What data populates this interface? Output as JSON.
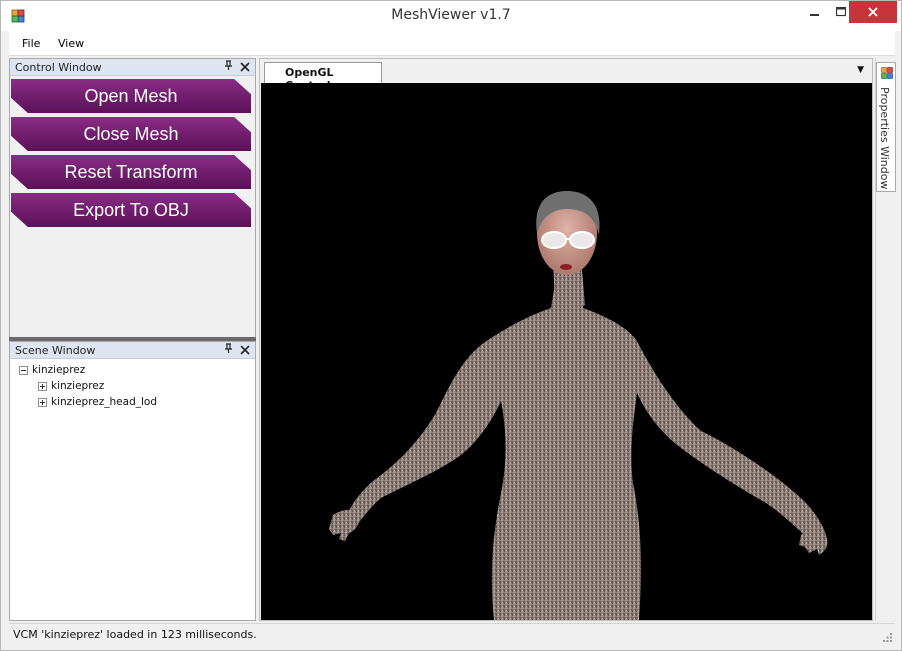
{
  "window": {
    "title": "MeshViewer v1.7"
  },
  "menu": {
    "items": [
      "File",
      "View"
    ]
  },
  "control_window": {
    "title": "Control Window",
    "buttons": [
      "Open Mesh",
      "Close Mesh",
      "Reset Transform",
      "Export To OBJ"
    ],
    "button_color": "#6e1d6b"
  },
  "scene_window": {
    "title": "Scene Window",
    "tree": {
      "root": "kinzieprez",
      "children": [
        "kinzieprez",
        "kinzieprez_head_lod"
      ]
    }
  },
  "document": {
    "tab_label": "OpenGL Control",
    "viewport_background": "#000000"
  },
  "properties_window": {
    "label": "Properties Window"
  },
  "status": {
    "text": "VCM 'kinzieprez' loaded in 123 milliseconds."
  },
  "colors": {
    "close_button": "#c7353a",
    "panel_header": "#dfe4f1",
    "mesh_texture": "#8b7d77"
  }
}
